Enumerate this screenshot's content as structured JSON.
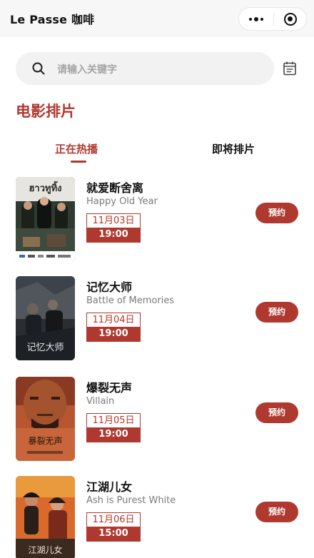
{
  "header": {
    "title": "Le Passe 咖啡"
  },
  "search": {
    "placeholder": "请输入关键字"
  },
  "section": {
    "title": "电影排片"
  },
  "tabs": [
    {
      "label": "正在热播",
      "active": true
    },
    {
      "label": "即将排片",
      "active": false
    }
  ],
  "movies": [
    {
      "title": "就爱断舍离",
      "subtitle": "Happy Old Year",
      "date": "11月03日",
      "time": "19:00",
      "action": "预约",
      "poster_text": "ฮาวทูทิ้ง"
    },
    {
      "title": "记忆大师",
      "subtitle": "Battle of Memories",
      "date": "11月04日",
      "time": "19:00",
      "action": "预约",
      "poster_text": "记忆大师"
    },
    {
      "title": "爆裂无声",
      "subtitle": "Villain",
      "date": "11月05日",
      "time": "19:00",
      "action": "预约",
      "poster_text": "暴裂无声"
    },
    {
      "title": "江湖儿女",
      "subtitle": "Ash is Purest White",
      "date": "11月06日",
      "time": "15:00",
      "action": "预约",
      "poster_text": "江湖儿女"
    }
  ],
  "colors": {
    "accent": "#b0392f",
    "search_bg": "#f2f2f2",
    "topbar_bg": "#f7f7f7"
  }
}
